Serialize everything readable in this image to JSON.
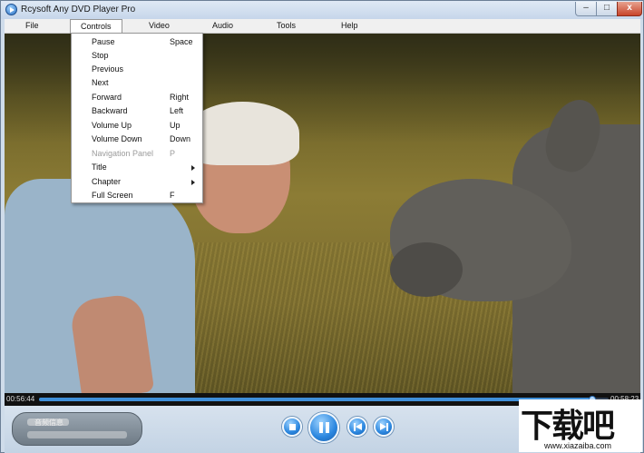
{
  "window": {
    "title": "Rcysoft Any DVD Player Pro",
    "min_label": "–",
    "max_label": "□",
    "close_label": "x"
  },
  "menubar": {
    "items": [
      {
        "label": "File"
      },
      {
        "label": "Controls",
        "active": true
      },
      {
        "label": "Video"
      },
      {
        "label": "Audio"
      },
      {
        "label": "Tools"
      },
      {
        "label": "Help"
      }
    ]
  },
  "controls_menu": {
    "items": [
      {
        "label": "Pause",
        "shortcut": "Space"
      },
      {
        "label": "Stop",
        "shortcut": ""
      },
      {
        "label": "Previous",
        "shortcut": ""
      },
      {
        "label": "Next",
        "shortcut": ""
      },
      {
        "label": "Forward",
        "shortcut": "Right"
      },
      {
        "label": "Backward",
        "shortcut": "Left"
      },
      {
        "label": "Volume Up",
        "shortcut": "Up"
      },
      {
        "label": "Volume Down",
        "shortcut": "Down"
      },
      {
        "label": "Navigation Panel",
        "shortcut": "P",
        "disabled": true
      },
      {
        "label": "Title",
        "shortcut": "",
        "submenu": true
      },
      {
        "label": "Chapter",
        "shortcut": "",
        "submenu": true
      },
      {
        "label": "Full Screen",
        "shortcut": "F"
      }
    ]
  },
  "playback": {
    "current_time": "00:56:44",
    "total_time": "00:58:23",
    "progress_fraction": 0.972
  },
  "info_panel": {
    "text": "音频信息"
  },
  "watermark": {
    "main": "下载吧",
    "sub": "www.xiazaiba.com"
  },
  "colors": {
    "accent": "#2a86df",
    "seek_fill": "#3f8fd8",
    "disabled_text": "#9b9b9b"
  },
  "icons": {
    "app": "app-play-icon",
    "stop": "stop-icon",
    "pause": "pause-icon",
    "previous": "previous-icon",
    "next": "next-icon",
    "submenu": "submenu-arrow-icon"
  }
}
